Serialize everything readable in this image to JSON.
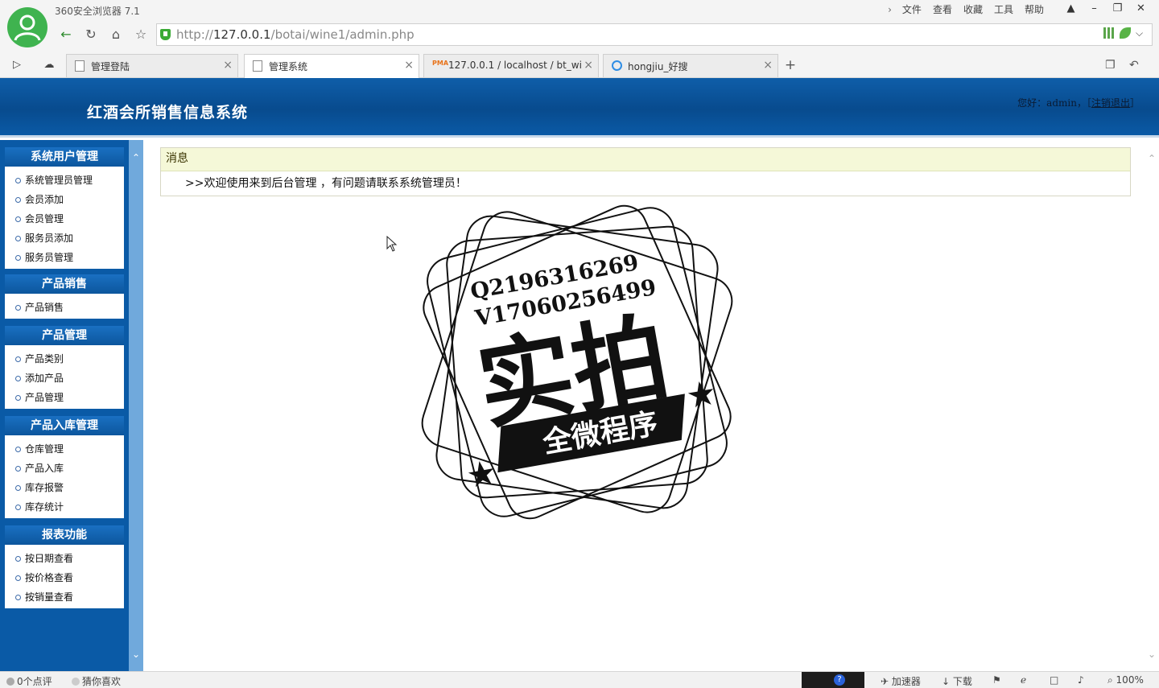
{
  "browser": {
    "app_title": "360安全浏览器 7.1",
    "menu": [
      "文件",
      "查看",
      "收藏",
      "工具",
      "帮助"
    ],
    "url": {
      "prefix": "http://",
      "host": "127.0.0.1",
      "path": "/botai/wine1/admin.php"
    },
    "tabs": [
      {
        "label": "管理登陆",
        "active": false
      },
      {
        "label": "管理系统",
        "active": true
      },
      {
        "label": "127.0.0.1 / localhost / bt_win",
        "active": false
      },
      {
        "label": "hongjiu_好搜",
        "active": false
      }
    ],
    "new_tab": "+"
  },
  "header": {
    "site_title": "红酒会所销售信息系统",
    "greeting_prefix": "您好：admin，［",
    "logout": "注销退出",
    "greeting_suffix": "］"
  },
  "sidebar": {
    "groups": [
      {
        "title": "系统用户管理",
        "items": [
          "系统管理员管理",
          "会员添加",
          "会员管理",
          "服务员添加",
          "服务员管理"
        ]
      },
      {
        "title": "产品销售",
        "items": [
          "产品销售"
        ]
      },
      {
        "title": "产品管理",
        "items": [
          "产品类别",
          "添加产品",
          "产品管理"
        ]
      },
      {
        "title": "产品入库管理",
        "items": [
          "仓库管理",
          "产品入库",
          "库存报警",
          "库存统计"
        ]
      },
      {
        "title": "报表功能",
        "items": [
          "按日期查看",
          "按价格查看",
          "按销量查看"
        ]
      }
    ]
  },
  "message": {
    "title": "消息",
    "text": ">>欢迎使用来到后台管理 ，有问题请联系系统管理员！"
  },
  "watermark": {
    "line1": "Q2196316269",
    "line2": "V17060256499",
    "big": "实拍",
    "banner": "全微程序"
  },
  "statusbar": {
    "comments": "0个点评",
    "guess": "猜你喜欢",
    "accelerator": "加速器",
    "download": "下载",
    "zoom": "100%"
  }
}
